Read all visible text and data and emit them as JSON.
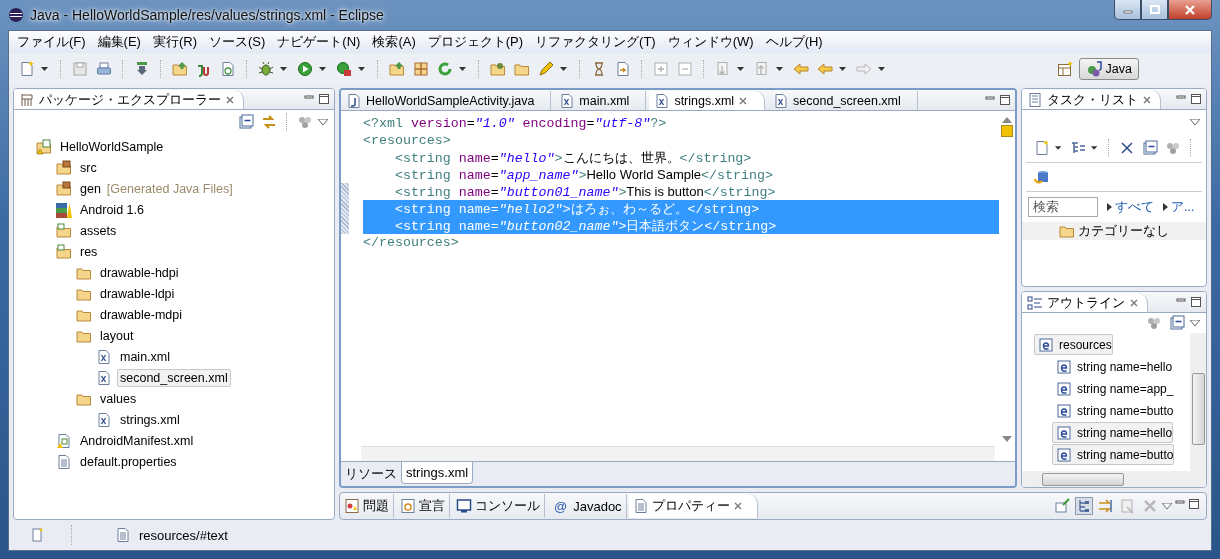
{
  "window": {
    "title": "Java - HelloWorldSample/res/values/strings.xml - Eclipse"
  },
  "menu": [
    {
      "label": "ファイル(F)"
    },
    {
      "label": "編集(E)"
    },
    {
      "label": "実行(R)"
    },
    {
      "label": "ソース(S)"
    },
    {
      "label": "ナビゲート(N)"
    },
    {
      "label": "検索(A)"
    },
    {
      "label": "プロジェクト(P)"
    },
    {
      "label": "リファクタリング(T)"
    },
    {
      "label": "ウィンドウ(W)"
    },
    {
      "label": "ヘルプ(H)"
    }
  ],
  "perspective": {
    "label": "Java",
    "selected": true
  },
  "explorer": {
    "title": "パッケージ・エクスプローラー",
    "tree": [
      {
        "label": "HelloWorldSample",
        "kind": "project",
        "selected": false,
        "children": [
          {
            "label": "src",
            "kind": "package-folder",
            "selected": false
          },
          {
            "label": "gen",
            "decoration": "[Generated Java Files]",
            "kind": "package-folder",
            "selected": false
          },
          {
            "label": "Android 1.6",
            "kind": "library",
            "selected": false
          },
          {
            "label": "assets",
            "kind": "source-folder",
            "selected": false
          },
          {
            "label": "res",
            "kind": "source-folder",
            "selected": false,
            "children": [
              {
                "label": "drawable-hdpi",
                "kind": "folder",
                "selected": false
              },
              {
                "label": "drawable-ldpi",
                "kind": "folder",
                "selected": false
              },
              {
                "label": "drawable-mdpi",
                "kind": "folder",
                "selected": false
              },
              {
                "label": "layout",
                "kind": "folder",
                "selected": false,
                "children": [
                  {
                    "label": "main.xml",
                    "kind": "xml",
                    "selected": false
                  },
                  {
                    "label": "second_screen.xml",
                    "kind": "xml",
                    "selected": true
                  }
                ]
              },
              {
                "label": "values",
                "kind": "folder",
                "selected": false,
                "children": [
                  {
                    "label": "strings.xml",
                    "kind": "xml",
                    "selected": false
                  }
                ]
              }
            ]
          },
          {
            "label": "AndroidManifest.xml",
            "kind": "manifest",
            "selected": false
          },
          {
            "label": "default.properties",
            "kind": "properties",
            "selected": false
          }
        ]
      }
    ]
  },
  "editor": {
    "tabs": [
      {
        "label": "HelloWorldSampleActivity.java",
        "kind": "java",
        "selected": false
      },
      {
        "label": "main.xml",
        "kind": "xml",
        "selected": false
      },
      {
        "label": "strings.xml",
        "kind": "xml",
        "selected": true
      },
      {
        "label": "second_screen.xml",
        "kind": "xml",
        "selected": false
      }
    ],
    "lines": [
      {
        "selected": false,
        "changed": false,
        "segments": [
          {
            "kind": "tag",
            "text": "<?xml"
          },
          {
            "kind": "attr",
            "text": " version"
          },
          {
            "kind": "plain",
            "text": "="
          },
          {
            "kind": "value",
            "text": "\"1.0\""
          },
          {
            "kind": "attr",
            "text": " encoding"
          },
          {
            "kind": "plain",
            "text": "="
          },
          {
            "kind": "value",
            "text": "\"utf-8\""
          },
          {
            "kind": "tag",
            "text": "?>"
          }
        ]
      },
      {
        "selected": false,
        "changed": false,
        "segments": [
          {
            "kind": "tag",
            "text": "<resources>"
          }
        ]
      },
      {
        "selected": false,
        "changed": false,
        "segments": [
          {
            "kind": "tag",
            "text": "    <string"
          },
          {
            "kind": "attr",
            "text": " name"
          },
          {
            "kind": "plain",
            "text": "="
          },
          {
            "kind": "value",
            "text": "\"hello\""
          },
          {
            "kind": "tag",
            "text": ">"
          },
          {
            "kind": "text",
            "text": "こんにちは、世界。"
          },
          {
            "kind": "tag",
            "text": "</string>"
          }
        ]
      },
      {
        "selected": false,
        "changed": false,
        "segments": [
          {
            "kind": "tag",
            "text": "    <string"
          },
          {
            "kind": "attr",
            "text": " name"
          },
          {
            "kind": "plain",
            "text": "="
          },
          {
            "kind": "value",
            "text": "\"app_name\""
          },
          {
            "kind": "tag",
            "text": ">"
          },
          {
            "kind": "text",
            "text": "Hello World Sample"
          },
          {
            "kind": "tag",
            "text": "</string>"
          }
        ]
      },
      {
        "selected": false,
        "changed": true,
        "segments": [
          {
            "kind": "tag",
            "text": "    <string"
          },
          {
            "kind": "attr",
            "text": " name"
          },
          {
            "kind": "plain",
            "text": "="
          },
          {
            "kind": "value",
            "text": "\"button01_name\""
          },
          {
            "kind": "tag",
            "text": ">"
          },
          {
            "kind": "text",
            "text": "This is button"
          },
          {
            "kind": "tag",
            "text": "</string>"
          }
        ]
      },
      {
        "selected": true,
        "changed": true,
        "segments": [
          {
            "kind": "tag",
            "text": "    <string"
          },
          {
            "kind": "attr",
            "text": " name"
          },
          {
            "kind": "plain",
            "text": "="
          },
          {
            "kind": "value",
            "text": "\"hello2\""
          },
          {
            "kind": "tag",
            "text": ">"
          },
          {
            "kind": "text",
            "text": "はろぉ、わ～るど。"
          },
          {
            "kind": "tag",
            "text": "</string>"
          }
        ]
      },
      {
        "selected": true,
        "changed": true,
        "segments": [
          {
            "kind": "tag",
            "text": "    <string"
          },
          {
            "kind": "attr",
            "text": " name"
          },
          {
            "kind": "plain",
            "text": "="
          },
          {
            "kind": "value",
            "text": "\"button02_name\""
          },
          {
            "kind": "tag",
            "text": ">"
          },
          {
            "kind": "text",
            "text": "日本語ボタン"
          },
          {
            "kind": "tag",
            "text": "</string>"
          }
        ]
      },
      {
        "selected": false,
        "changed": false,
        "segments": [
          {
            "kind": "tag",
            "text": "</resources>"
          }
        ]
      }
    ],
    "bottom_tabs": [
      {
        "label": "リソース",
        "selected": false
      },
      {
        "label": "strings.xml",
        "selected": true
      }
    ]
  },
  "tasks": {
    "title": "タスク・リスト",
    "search": {
      "placeholder": "検索"
    },
    "filters": [
      "すべて",
      "ア..."
    ],
    "category": "カテゴリーなし"
  },
  "outline": {
    "title": "アウトライン",
    "tree": [
      {
        "label": "resources",
        "selected": true,
        "children": [
          {
            "label": "string name=hello",
            "selected": false
          },
          {
            "label": "string name=app_",
            "selected": false
          },
          {
            "label": "string name=butto",
            "selected": false
          },
          {
            "label": "string name=hello",
            "selected": true
          },
          {
            "label": "string name=butto",
            "selected": true
          }
        ]
      }
    ]
  },
  "bottom_panel": {
    "tabs": [
      {
        "label": "問題",
        "kind": "problems",
        "selected": false
      },
      {
        "label": "宣言",
        "kind": "declaration",
        "selected": false
      },
      {
        "label": "コンソール",
        "kind": "console",
        "selected": false
      },
      {
        "label": "Javadoc",
        "kind": "javadoc",
        "icon_char": "@",
        "selected": false
      },
      {
        "label": "プロパティー",
        "kind": "properties",
        "selected": true
      }
    ]
  },
  "status_bar": {
    "text": "resources/#text"
  }
}
